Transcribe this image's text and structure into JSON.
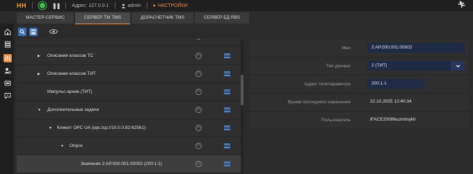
{
  "topbar": {
    "logo": "HH",
    "address": "Адрес: 127.0.0.1",
    "user": "admin",
    "settings": "НАСТРОЙКИ"
  },
  "tabs": [
    {
      "label": "МАСТЕР-СЕРВИС",
      "active": false
    },
    {
      "label": "СЕРВЕР ТМ TMS",
      "active": true
    },
    {
      "label": "ДОРАСЧЕТЧИК TMS",
      "active": false
    },
    {
      "label": "СЕРВЕР БД RBS",
      "active": false
    }
  ],
  "tree": {
    "rows": [
      {
        "label": "Описания классов ТС",
        "arrow": "▶"
      },
      {
        "label": "Описания классов ТИТ",
        "arrow": "▶"
      },
      {
        "label": "Импульс-архив (ТИТ)",
        "arrow": ""
      },
      {
        "label": "Дополнительные задачи",
        "arrow": "▼"
      },
      {
        "label": "Клиент OPC UA (opc.tcp://10.0.0.82:62561)",
        "arrow": "▼"
      },
      {
        "label": "Опрос",
        "arrow": "▼"
      },
      {
        "label": "Значение 2:AP.000:001:00002 (200:1:1)",
        "arrow": ""
      }
    ]
  },
  "properties": {
    "name_label": "Имя",
    "name_value": "2:AP.000:001:00002",
    "type_label": "Тип данных",
    "type_value": "2 (ТИТ)",
    "address_label": "Адрес телепараметра",
    "address_value": "200:1:1",
    "modified_label": "Время последнего изменения",
    "modified_value": "22.10.2025 12:40:34",
    "user_label": "Пользователь",
    "user_value": "IFACE2008\\kuzminykh"
  },
  "colors": {
    "accent": "#f08a3c",
    "button": "#3d6fb8",
    "play": "#3cc14a"
  }
}
